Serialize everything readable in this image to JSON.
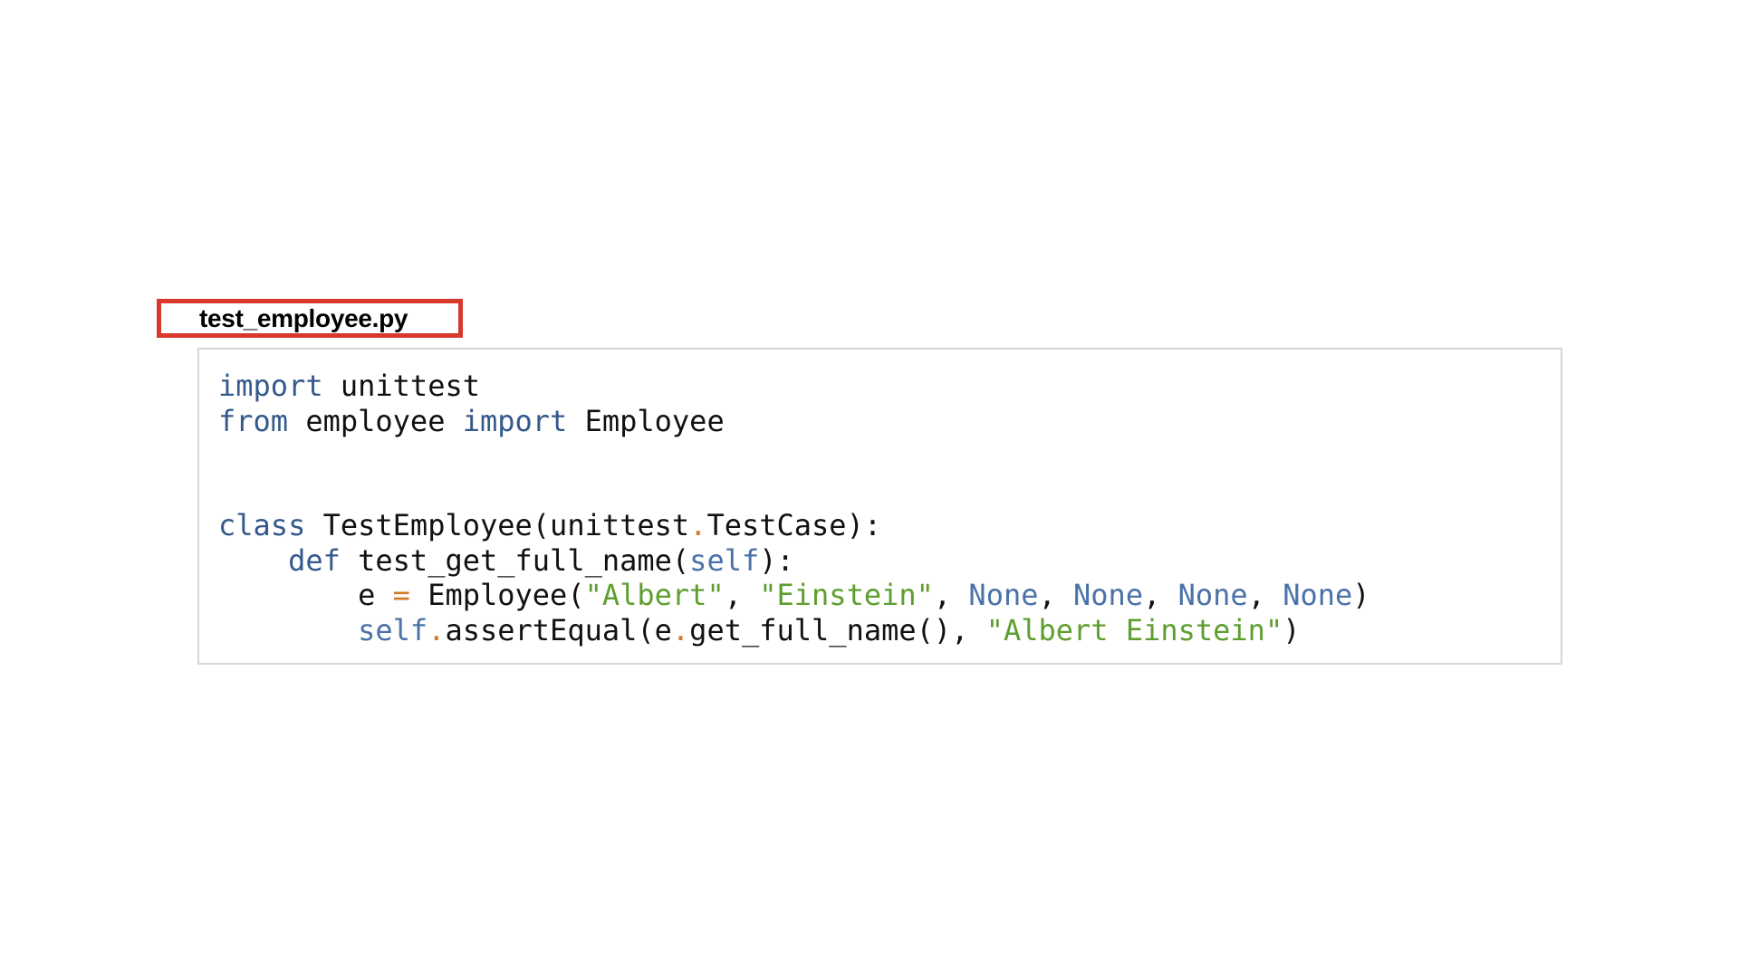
{
  "file": {
    "name": "test_employee.py"
  },
  "code": {
    "lines": [
      [
        {
          "t": "import",
          "c": "kw"
        },
        {
          "t": " unittest",
          "c": "plain"
        }
      ],
      [
        {
          "t": "from",
          "c": "kw"
        },
        {
          "t": " employee ",
          "c": "plain"
        },
        {
          "t": "import",
          "c": "kw"
        },
        {
          "t": " Employee",
          "c": "plain"
        }
      ],
      [],
      [],
      [
        {
          "t": "class",
          "c": "kw"
        },
        {
          "t": " TestEmployee(unittest",
          "c": "plain"
        },
        {
          "t": ".",
          "c": "op"
        },
        {
          "t": "TestCase):",
          "c": "plain"
        }
      ],
      [
        {
          "t": "    ",
          "c": "plain"
        },
        {
          "t": "def",
          "c": "kw"
        },
        {
          "t": " test_get_full_name(",
          "c": "plain"
        },
        {
          "t": "self",
          "c": "bi"
        },
        {
          "t": "):",
          "c": "plain"
        }
      ],
      [
        {
          "t": "        e ",
          "c": "plain"
        },
        {
          "t": "=",
          "c": "op"
        },
        {
          "t": " Employee(",
          "c": "plain"
        },
        {
          "t": "\"Albert\"",
          "c": "str"
        },
        {
          "t": ", ",
          "c": "plain"
        },
        {
          "t": "\"Einstein\"",
          "c": "str"
        },
        {
          "t": ", ",
          "c": "plain"
        },
        {
          "t": "None",
          "c": "bi"
        },
        {
          "t": ", ",
          "c": "plain"
        },
        {
          "t": "None",
          "c": "bi"
        },
        {
          "t": ", ",
          "c": "plain"
        },
        {
          "t": "None",
          "c": "bi"
        },
        {
          "t": ", ",
          "c": "plain"
        },
        {
          "t": "None",
          "c": "bi"
        },
        {
          "t": ")",
          "c": "plain"
        }
      ],
      [
        {
          "t": "        ",
          "c": "plain"
        },
        {
          "t": "self",
          "c": "bi"
        },
        {
          "t": ".",
          "c": "op"
        },
        {
          "t": "assertEqual(e",
          "c": "plain"
        },
        {
          "t": ".",
          "c": "op"
        },
        {
          "t": "get_full_name(), ",
          "c": "plain"
        },
        {
          "t": "\"Albert Einstein\"",
          "c": "str"
        },
        {
          "t": ")",
          "c": "plain"
        }
      ]
    ]
  },
  "colors": {
    "label_border": "#d9382c",
    "code_border": "#d6d6d6",
    "keyword": "#34598c",
    "builtin": "#4a72a8",
    "string": "#5e9e2f",
    "operator": "#d27a2a",
    "text": "#111111"
  }
}
